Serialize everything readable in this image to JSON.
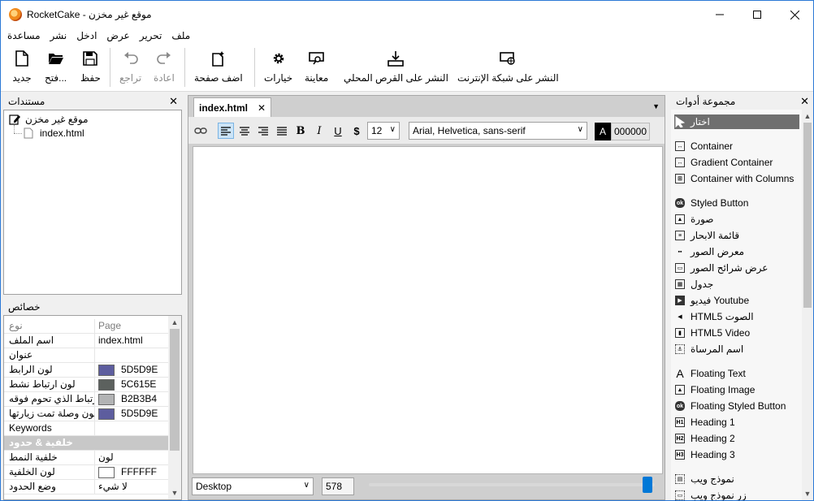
{
  "window": {
    "title": "RocketCake - موقع غير مخزن"
  },
  "menu": [
    "مساعدة",
    "نشر",
    "ادخل",
    "عرض",
    "تحرير",
    "ملف"
  ],
  "toolbar": {
    "new": "جديد",
    "open": "فتح...",
    "save": "حفظ",
    "undo": "تراجع",
    "redo": "اعادة",
    "add_page": "اضف صفحة",
    "options": "خيارات",
    "preview": "معاينة",
    "publish_local": "النشر على القرص المحلي",
    "publish_internet": "النشر على شبكة الإنترنت"
  },
  "documents": {
    "title": "مستندات",
    "site": "موقع غير مخزن",
    "page": "index.html"
  },
  "properties": {
    "title": "خصائص",
    "header": {
      "key": "نوع",
      "value": "Page"
    },
    "rows": [
      {
        "key": "اسم الملف",
        "value": "index.html"
      },
      {
        "key": "عنوان",
        "value": ""
      },
      {
        "key": "لون الرابط",
        "value": "5D5D9E",
        "color": "#5D5D9E"
      },
      {
        "key": "لون ارتباط نشط",
        "value": "5C615E",
        "color": "#5C615E"
      },
      {
        "key": "لون ارتباط الذي تحوم فوقه",
        "value": "B2B3B4",
        "color": "#B2B3B4"
      },
      {
        "key": "لون وصلة تمت زيارتها",
        "value": "5D5D9E",
        "color": "#5D5D9E"
      },
      {
        "key": "Keywords",
        "value": ""
      }
    ],
    "category": "خلفية & حدود",
    "rows2": [
      {
        "key": "خلفية النمط",
        "value": "لون"
      },
      {
        "key": "لون الخلفية",
        "value": "FFFFFF",
        "color": "#FFFFFF"
      },
      {
        "key": "وضع الحدود",
        "value": "لا شيء"
      }
    ]
  },
  "editor": {
    "tab": "index.html",
    "font_size": "12",
    "font_family": "Arial, Helvetica, sans-serif",
    "color_label": "A",
    "color_value": "000000",
    "view_mode": "Desktop",
    "width_value": "578",
    "slider_fraction": 0.99
  },
  "toolbox": {
    "title": "مجموعة أدوات",
    "items": [
      {
        "label": "اختار",
        "icon": "cursor-icon",
        "selected": true
      },
      {
        "label": "Container",
        "icon": "container-icon"
      },
      {
        "label": "Gradient Container",
        "icon": "gradient-container-icon"
      },
      {
        "label": "Container with Columns",
        "icon": "columns-icon"
      },
      {
        "label": "Styled Button",
        "icon": "styled-button-icon"
      },
      {
        "label": "صورة",
        "icon": "image-icon"
      },
      {
        "label": "قائمة الابحار",
        "icon": "nav-menu-icon"
      },
      {
        "label": "معرض الصور",
        "icon": "gallery-icon"
      },
      {
        "label": "عرض شرائح الصور",
        "icon": "slideshow-icon"
      },
      {
        "label": "جدول",
        "icon": "table-icon"
      },
      {
        "label": "فيديو Youtube",
        "icon": "youtube-icon"
      },
      {
        "label": "HTML5 الصوت",
        "icon": "audio-icon"
      },
      {
        "label": "HTML5 Video",
        "icon": "video-icon"
      },
      {
        "label": "اسم المرساة",
        "icon": "anchor-icon"
      },
      {
        "label": "Floating Text",
        "icon": "floating-text-icon"
      },
      {
        "label": "Floating Image",
        "icon": "floating-image-icon"
      },
      {
        "label": "Floating Styled Button",
        "icon": "floating-button-icon"
      },
      {
        "label": "Heading 1",
        "icon": "h1-icon"
      },
      {
        "label": "Heading 2",
        "icon": "h2-icon"
      },
      {
        "label": "Heading 3",
        "icon": "h3-icon"
      },
      {
        "label": "نموذج ويب",
        "icon": "web-form-icon"
      },
      {
        "label": "زر نموذج ويب",
        "icon": "form-button-icon"
      }
    ]
  }
}
